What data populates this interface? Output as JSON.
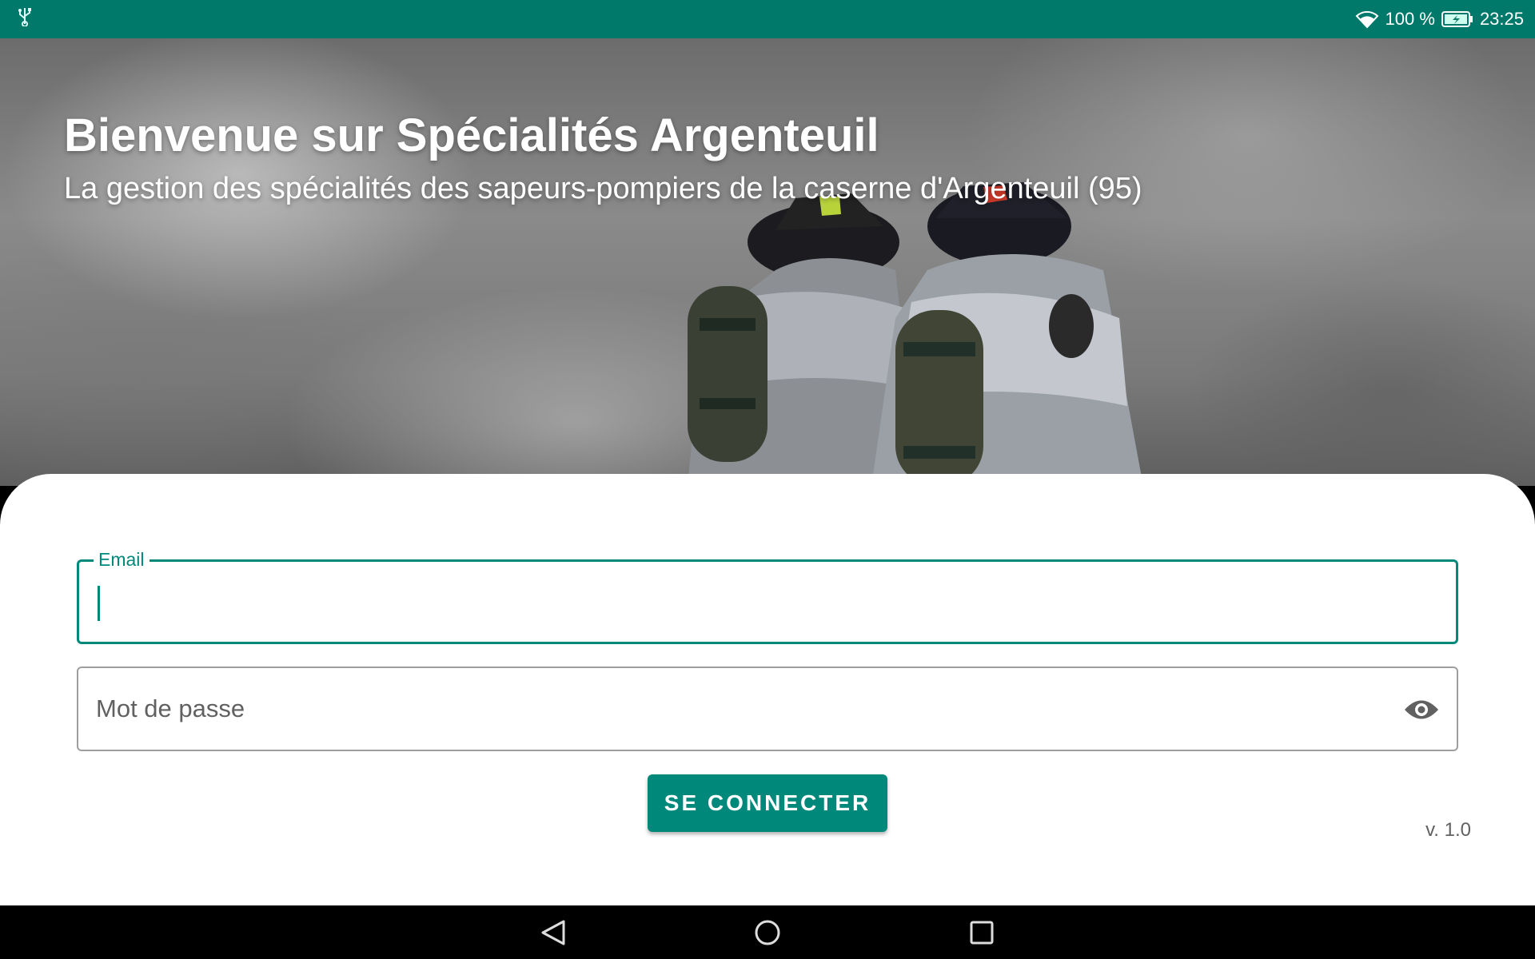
{
  "status_bar": {
    "usb_icon": "usb-icon",
    "wifi_icon": "wifi-icon",
    "battery_percent": "100 %",
    "battery_icon": "battery-charging-icon",
    "time": "23:25",
    "background_color": "#00796B"
  },
  "hero": {
    "title": "Bienvenue sur Spécialités Argenteuil",
    "subtitle": "La gestion des spécialités des sapeurs-pompiers de la caserne d'Argenteuil (95)",
    "image": "firefighters-in-smoke-photo"
  },
  "login_form": {
    "email": {
      "label": "Email",
      "value": ""
    },
    "password": {
      "placeholder": "Mot de passe",
      "value": "",
      "toggle_icon": "eye-icon"
    },
    "submit_label": "SE CONNECTER",
    "version": "v. 1.0",
    "accent_color": "#00897B"
  },
  "nav_bar": {
    "back_icon": "back-triangle-icon",
    "home_icon": "home-circle-icon",
    "recents_icon": "recents-square-icon"
  }
}
